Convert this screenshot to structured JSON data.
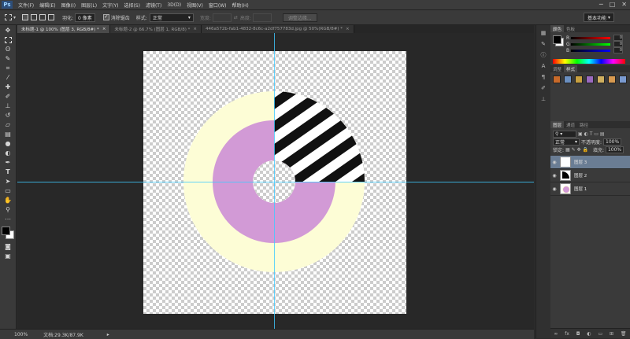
{
  "app": {
    "logo": "Ps",
    "window_controls": [
      "─",
      "□",
      "✕"
    ]
  },
  "menu": [
    "文件(F)",
    "编辑(E)",
    "图像(I)",
    "图层(L)",
    "文字(Y)",
    "选择(S)",
    "滤镜(T)",
    "3D(D)",
    "视图(V)",
    "窗口(W)",
    "帮助(H)"
  ],
  "options": {
    "feather_label": "羽化:",
    "feather_value": "0 像素",
    "antialias_label": "消除锯齿",
    "style_label": "样式:",
    "style_value": "正常",
    "width_label": "宽度:",
    "height_label": "高度:",
    "refine_edge": "调整边缘...",
    "workspace": "基本功能"
  },
  "tabs": [
    {
      "label": "未标题-1 @ 100% (图层 3, RGB/8#) *",
      "active": true
    },
    {
      "label": "未标题-2 @ 66.7% (图层 1, RGB/8) *",
      "active": false
    },
    {
      "label": "446a572b-fab1-4832-8c6c-a2df757783d.jpg @ 50%(RGB/8#) *",
      "active": false
    }
  ],
  "toolbar_icons": [
    "move-icon",
    "marquee-icon",
    "lasso-icon",
    "quick-select-icon",
    "crop-icon",
    "eyedropper-icon",
    "healing-icon",
    "brush-icon",
    "clone-stamp-icon",
    "history-brush-icon",
    "eraser-icon",
    "gradient-icon",
    "blur-icon",
    "dodge-icon",
    "pen-icon",
    "type-icon",
    "path-select-icon",
    "rectangle-icon",
    "hand-icon",
    "zoom-icon"
  ],
  "status": {
    "zoom": "100%",
    "doc_info": "文档:29.3K/87.9K"
  },
  "color_panel": {
    "tabs": [
      "颜色",
      "色板"
    ],
    "r_label": "R",
    "g_label": "G",
    "b_label": "B",
    "r_value": "0",
    "g_value": "0",
    "b_value": "0"
  },
  "adjust_panel": {
    "tabs": [
      "调整",
      "样式"
    ]
  },
  "layers_panel": {
    "tabs": [
      "图层",
      "通道",
      "路径"
    ],
    "blend_mode": "正常",
    "opacity_label": "不透明度:",
    "opacity_value": "100%",
    "lock_label": "锁定:",
    "fill_label": "填充:",
    "fill_value": "100%",
    "layers": [
      {
        "name": "图层 3",
        "selected": true
      },
      {
        "name": "图层 2",
        "selected": false
      },
      {
        "name": "图层 1",
        "selected": false
      }
    ]
  },
  "colors": {
    "ring_yellow": "#fdfdd6",
    "ring_purple": "#d29ad6",
    "stripe_black": "#111111",
    "guide_cyan": "#3ec9ff",
    "selected_layer": "#6a7d94"
  }
}
